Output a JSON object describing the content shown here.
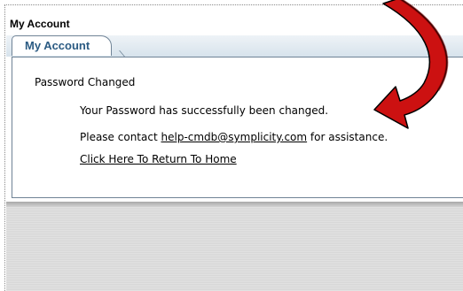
{
  "window": {
    "title": "My Account"
  },
  "tabs": [
    {
      "label": "My Account"
    }
  ],
  "content": {
    "heading": "Password Changed",
    "message": "Your Password has successfully been changed.",
    "contact_prefix": "Please contact",
    "contact_email": "help-cmdb@symplicity.com",
    "contact_suffix": "for assistance.",
    "home_link": "Click Here To Return To Home"
  },
  "colors": {
    "tab_text": "#2b5b83",
    "border": "#6f8396",
    "arrow": "#cc1111"
  },
  "annotation": {
    "icon": "red-curved-arrow-icon"
  }
}
